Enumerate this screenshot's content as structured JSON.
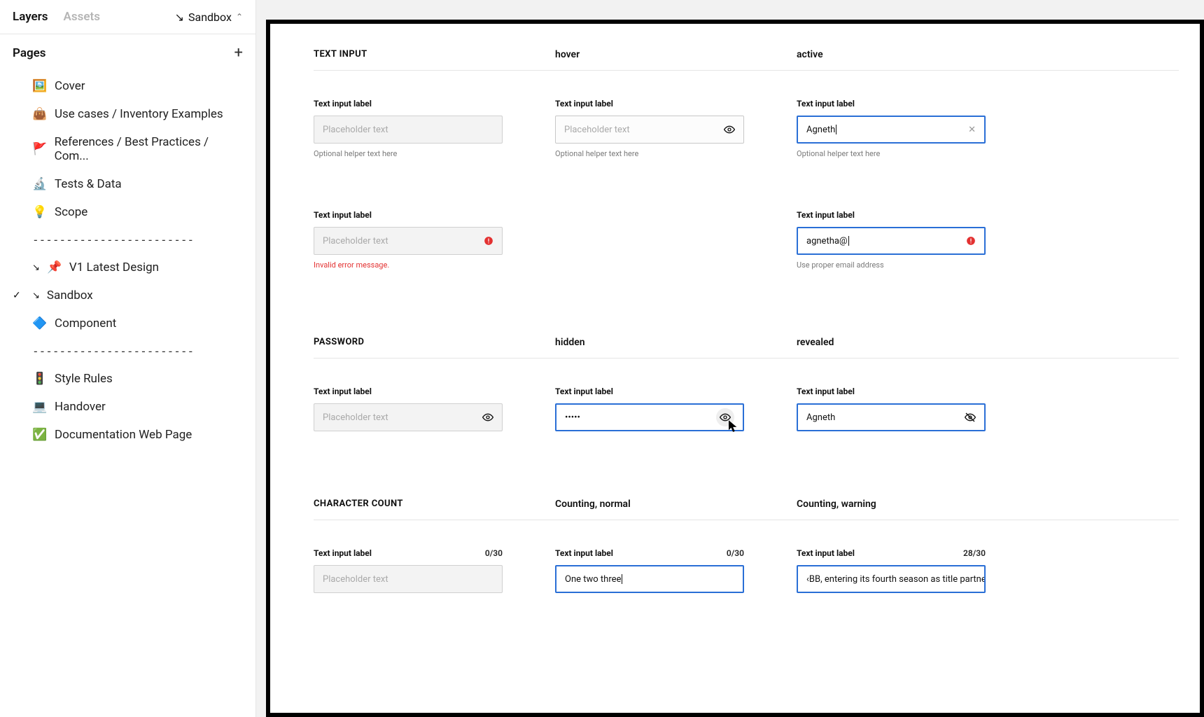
{
  "sidebar": {
    "tabs": {
      "layers": "Layers",
      "assets": "Assets"
    },
    "crumb": {
      "arrow": "↘",
      "label": "Sandbox"
    },
    "pages_title": "Pages",
    "dashes": "------------------------",
    "items": {
      "cover": {
        "emoji": "🖼️",
        "label": "Cover"
      },
      "usecases": {
        "emoji": "👜",
        "label": "Use cases / Inventory Examples"
      },
      "references": {
        "emoji": "🚩",
        "label": "References  / Best Practices / Com..."
      },
      "tests": {
        "emoji": "🔬",
        "label": "Tests & Data"
      },
      "scope": {
        "emoji": "💡",
        "label": "Scope"
      },
      "latest": {
        "emoji": "📌",
        "arrow": "↘",
        "label": "V1  Latest Design"
      },
      "sandbox": {
        "arrow": "↘",
        "label": "Sandbox"
      },
      "component": {
        "emoji": "🔷",
        "label": "Component"
      },
      "stylerules": {
        "emoji": "🚦",
        "label": "Style Rules"
      },
      "handover": {
        "emoji": "💻",
        "label": "Handover"
      },
      "docs": {
        "emoji": "✅",
        "label": "Documentation Web Page"
      }
    }
  },
  "canvas": {
    "section_text_input": {
      "header": "TEXT INPUT",
      "col2": "hover",
      "col3": "active",
      "row1": {
        "label": "Text input label",
        "placeholder": "Placeholder text",
        "helper": "Optional helper text here",
        "active_value": "Agneth"
      },
      "row2": {
        "label": "Text input label",
        "placeholder": "Placeholder text",
        "error_msg": "Invalid error message.",
        "active_value": "agnetha@",
        "active_helper": "Use proper email address"
      }
    },
    "section_password": {
      "header": "PASSWORD",
      "col2": "hidden",
      "col3": "revealed",
      "label": "Text input label",
      "placeholder": "Placeholder text",
      "hidden_value": "•••••",
      "revealed_value": "Agneth"
    },
    "section_charcount": {
      "header": "CHARACTER COUNT",
      "col2": "Counting, normal",
      "col3": "Counting, warning",
      "label": "Text input label",
      "placeholder": "Placeholder text",
      "c1_counter": "0/30",
      "c2_counter": "0/30",
      "c3_counter": "28/30",
      "c2_value": "One two three",
      "c3_value": "‹BB, entering its fourth season as title partner, is conti"
    }
  }
}
